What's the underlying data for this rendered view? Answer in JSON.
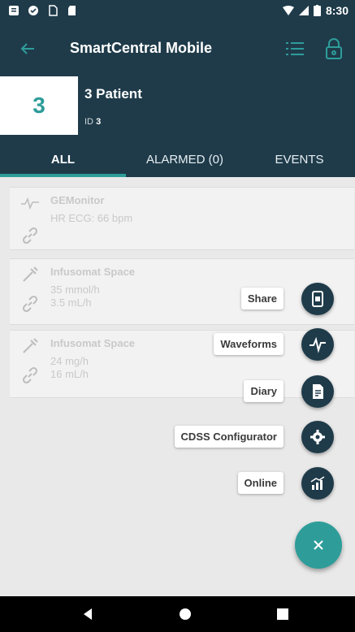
{
  "status_bar": {
    "time": "8:30"
  },
  "app_bar": {
    "title": "SmartCentral Mobile"
  },
  "patient": {
    "number": "3",
    "name": "3 Patient",
    "id_label": "ID",
    "id_value": "3"
  },
  "tabs": [
    {
      "label": "ALL",
      "selected": true
    },
    {
      "label": "ALARMED (0)",
      "selected": false
    },
    {
      "label": "EVENTS",
      "selected": false
    }
  ],
  "devices": [
    {
      "name": "GEMonitor",
      "lines": [
        "HR ECG: 66 bpm"
      ]
    },
    {
      "name": "Infusomat Space",
      "lines": [
        "35 mmol/h",
        "3.5 mL/h"
      ]
    },
    {
      "name": "Infusomat Space",
      "lines": [
        "24 mg/h",
        "16 mL/h"
      ]
    }
  ],
  "fab_menu": [
    {
      "label": "Share",
      "icon": "share-tablet-icon"
    },
    {
      "label": "Waveforms",
      "icon": "waveform-icon"
    },
    {
      "label": "Diary",
      "icon": "diary-icon"
    },
    {
      "label": "CDSS Configurator",
      "icon": "gear-icon"
    },
    {
      "label": "Online",
      "icon": "chart-online-icon"
    }
  ],
  "colors": {
    "primary": "#1f3b4a",
    "accent": "#2e9d9a"
  }
}
